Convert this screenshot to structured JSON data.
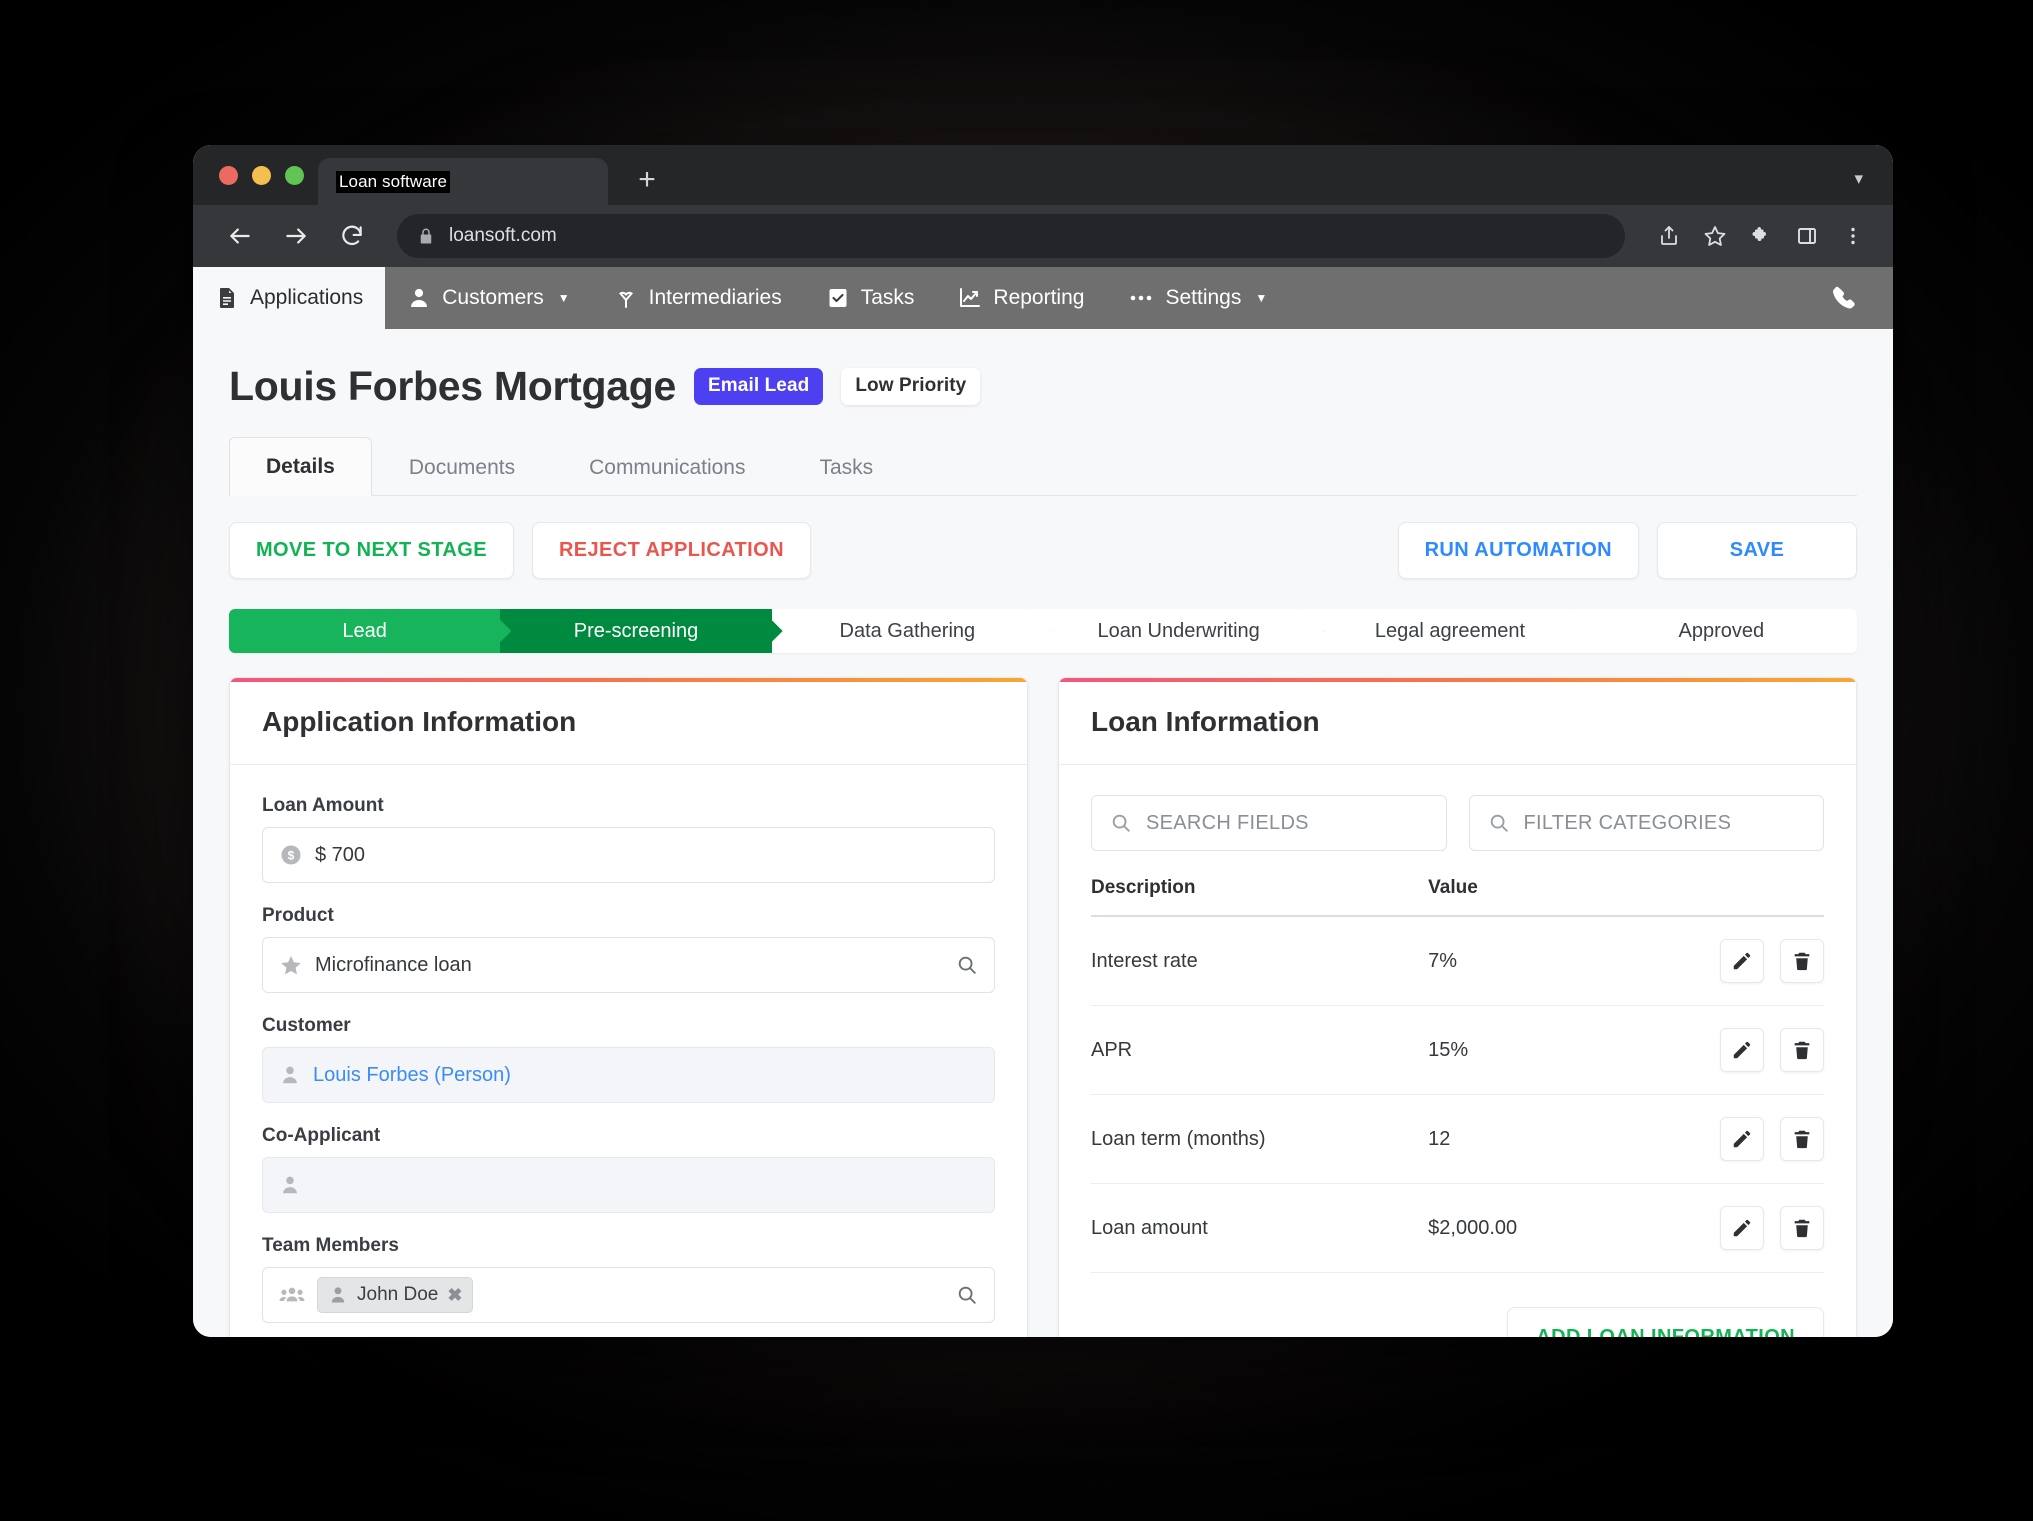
{
  "browser": {
    "tab_title": "Loan software",
    "new_tab_label": "+",
    "url": "loansoft.com",
    "icons": {
      "back": "back-arrow-icon",
      "forward": "forward-arrow-icon",
      "reload": "reload-icon",
      "lock": "lock-icon",
      "share": "share-icon",
      "bookmark": "star-icon",
      "extensions": "puzzle-icon",
      "sidepanel": "side-panel-icon",
      "menu": "three-dot-menu-icon",
      "window_chevron": "chevron-down-icon"
    }
  },
  "appnav": {
    "items": [
      {
        "label": "Applications",
        "icon": "document-icon",
        "active": true,
        "caret": false
      },
      {
        "label": "Customers",
        "icon": "person-icon",
        "active": false,
        "caret": true
      },
      {
        "label": "Intermediaries",
        "icon": "sprout-icon",
        "active": false,
        "caret": false
      },
      {
        "label": "Tasks",
        "icon": "checkbox-icon",
        "active": false,
        "caret": false
      },
      {
        "label": "Reporting",
        "icon": "chart-icon",
        "active": false,
        "caret": false
      },
      {
        "label": "Settings",
        "icon": "ellipsis-icon",
        "active": false,
        "caret": true
      }
    ],
    "phone_icon": "phone-icon"
  },
  "header": {
    "title": "Louis Forbes Mortgage",
    "badges": [
      {
        "label": "Email Lead",
        "style": "primary",
        "color": "#4c40f0"
      },
      {
        "label": "Low Priority",
        "style": "light",
        "color": "#ffffff"
      }
    ]
  },
  "subtabs": [
    {
      "label": "Details",
      "active": true
    },
    {
      "label": "Documents",
      "active": false
    },
    {
      "label": "Communications",
      "active": false
    },
    {
      "label": "Tasks",
      "active": false
    }
  ],
  "actions": {
    "move_to_next_stage": "MOVE TO NEXT STAGE",
    "reject_application": "REJECT APPLICATION",
    "run_automation": "RUN AUTOMATION",
    "save": "SAVE"
  },
  "stages": [
    {
      "label": "Lead",
      "state": "done"
    },
    {
      "label": "Pre-screening",
      "state": "current"
    },
    {
      "label": "Data Gathering",
      "state": "plain"
    },
    {
      "label": "Loan Underwriting",
      "state": "plain"
    },
    {
      "label": "Legal agreement",
      "state": "plain"
    },
    {
      "label": "Approved",
      "state": "plain"
    }
  ],
  "application_card": {
    "title": "Application Information",
    "fields": [
      {
        "label": "Loan Amount",
        "value": "$ 700",
        "icon": "dollar-circle-icon",
        "kind": "text",
        "trailing": ""
      },
      {
        "label": "Product",
        "value": "Microfinance loan",
        "icon": "star-icon",
        "kind": "text",
        "trailing": "search-icon"
      },
      {
        "label": "Customer",
        "value": "Louis Forbes (Person)",
        "icon": "person-icon",
        "kind": "link",
        "trailing": ""
      },
      {
        "label": "Co-Applicant",
        "value": "",
        "icon": "person-icon",
        "kind": "empty",
        "trailing": ""
      },
      {
        "label": "Team Members",
        "value": "John Doe",
        "icon": "people-icon",
        "kind": "chip",
        "trailing": "search-icon",
        "chip_remove": "✖"
      }
    ]
  },
  "loan_card": {
    "title": "Loan Information",
    "search_fields_placeholder": "SEARCH FIELDS",
    "filter_categories_placeholder": "FILTER CATEGORIES",
    "columns": [
      "Description",
      "Value"
    ],
    "rows": [
      {
        "description": "Interest rate",
        "value": "7%"
      },
      {
        "description": "APR",
        "value": "15%"
      },
      {
        "description": "Loan term (months)",
        "value": "12"
      },
      {
        "description": "Loan amount",
        "value": "$2,000.00"
      }
    ],
    "row_actions": {
      "edit": "pencil-icon",
      "delete": "trash-icon"
    },
    "add_button": "ADD LOAN INFORMATION"
  },
  "colors": {
    "nav_bg": "#6f6f6f",
    "accent_green": "#12b353",
    "stage_done": "#17b45c",
    "stage_current": "#008a3f",
    "danger_red": "#e8564e",
    "link_blue": "#2f8bfd",
    "badge_indigo": "#4c40f0",
    "card_gradient_start": "#f2567f",
    "card_gradient_end": "#f6a832"
  }
}
